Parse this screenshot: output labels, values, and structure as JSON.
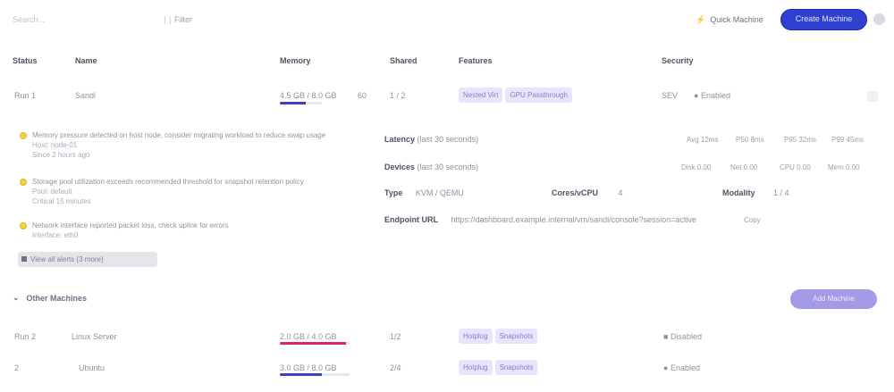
{
  "toolbar": {
    "search_placeholder": "Search...",
    "filter_label": "Filter",
    "quick_label": "Quick Machine",
    "create_label": "Create Machine"
  },
  "table": {
    "headers": [
      "Status",
      "Name",
      "Memory",
      "Shared",
      "Features",
      "Security"
    ]
  },
  "rows": [
    {
      "status": "Run 1",
      "name": "Sandi",
      "memory": "4.5 GB / 8.0 GB",
      "memory_value": "60",
      "memory_pct": 0.62,
      "memory_color": "#3b3fcf",
      "shared": "1 / 2",
      "features": [
        "Nested Virt",
        "GPU Passthrough"
      ],
      "security": "SEV",
      "security_state": "Enabled"
    },
    {
      "status": "Run 2",
      "name": "Linux Server",
      "memory": "2.0 GB / 4.0 GB",
      "memory_pct": 0.95,
      "memory_color": "#e0245e",
      "shared": "1/2",
      "features": [
        "Hotplug",
        "Snapshots"
      ],
      "security": "",
      "security_state": "Disabled"
    },
    {
      "status": "2",
      "name": "Ubuntu",
      "memory": "3.0 GB / 8.0 GB",
      "memory_pct": 0.6,
      "memory_color": "#3b3fcf",
      "shared": "2/4",
      "features": [
        "Hotplug",
        "Snapshots"
      ],
      "security": "",
      "security_state": "Enabled"
    }
  ],
  "warnings": [
    {
      "text": "Memory pressure detected on host node, consider migrating workload to reduce swap usage",
      "sub1": "Host: node-01",
      "sub2": "Since 2 hours ago"
    },
    {
      "text": "Storage pool utilization exceeds recommended threshold for snapshot retention policy",
      "sub1": "Pool: default",
      "sub2": "Critical 15 minutes"
    },
    {
      "text": "Network interface reported packet loss, check uplink for errors",
      "sub1": "Interface: eth0"
    }
  ],
  "more_link": "View all alerts (3 more)",
  "metrics": {
    "latency_label": "Latency",
    "latency_sub": "(last 30 seconds)",
    "latency_values": [
      "Avg 12ms",
      "P50 8ms",
      "P95 32ms",
      "P99 45ms"
    ],
    "devices_label": "Devices",
    "devices_sub": "(last 30 seconds)",
    "devices_values": [
      "Disk 0.00",
      "Net 0.00",
      "CPU 0.00",
      "Mem 0.00"
    ],
    "type_label": "Type",
    "type_value": "KVM / QEMU",
    "cores_label": "Cores/vCPU",
    "cores_value": "4",
    "modality_label": "Modality",
    "modality_value": "1 / 4",
    "endpoint_label": "Endpoint URL",
    "endpoint_value": "https://dashboard.example.internal/vm/sandi/console?session=active",
    "endpoint_copy": "Copy"
  },
  "section": {
    "title": "Other Machines",
    "button": "Add Machine"
  }
}
